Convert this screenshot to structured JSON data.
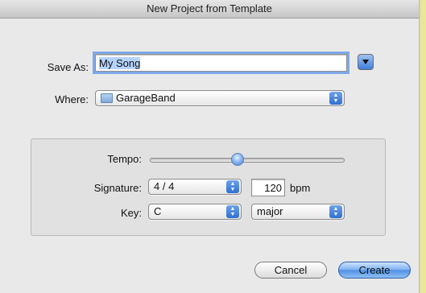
{
  "window": {
    "title": "New Project from Template"
  },
  "save_as": {
    "label": "Save As:",
    "value": "My Song"
  },
  "where": {
    "label": "Where:",
    "value": "GarageBand",
    "icon": "folder-icon"
  },
  "settings": {
    "tempo": {
      "label": "Tempo:",
      "slider_fraction": 0.45
    },
    "signature": {
      "label": "Signature:",
      "value": "4 / 4"
    },
    "bpm": {
      "value": "120",
      "unit": "bpm"
    },
    "key": {
      "label": "Key:",
      "note": "C",
      "mode": "major"
    }
  },
  "buttons": {
    "cancel": "Cancel",
    "create": "Create"
  },
  "colors": {
    "accent": "#3f7fdc",
    "selection": "#b5d3ff",
    "focus_ring": "#7ea9e8"
  }
}
